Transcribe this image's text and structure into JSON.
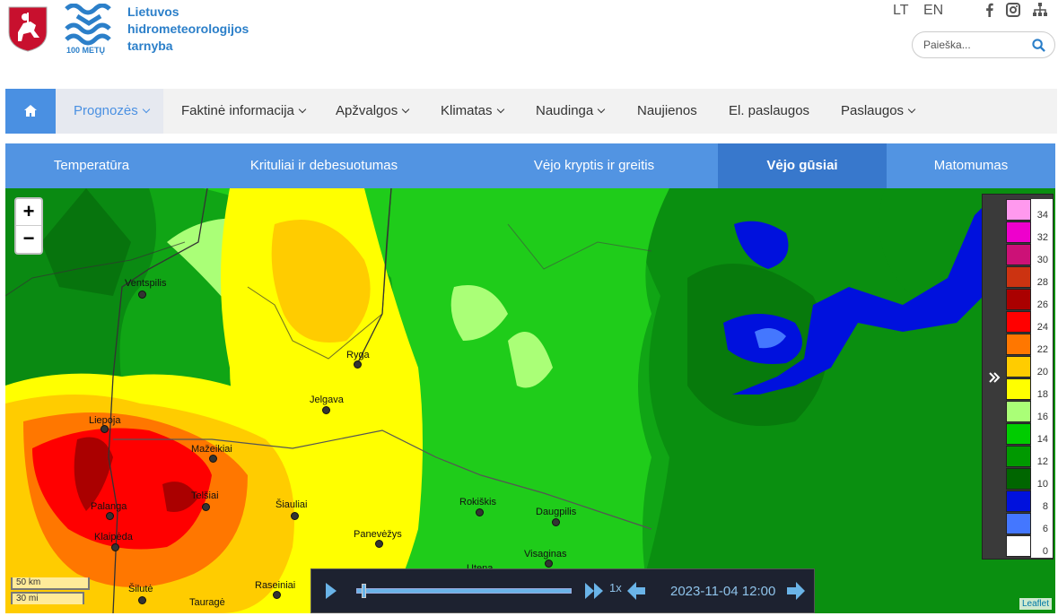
{
  "header": {
    "brand_lines": [
      "Lietuvos",
      "hidrometeorologijos",
      "tarnyba"
    ],
    "logo_caption": "100 METŲ",
    "languages": [
      "LT",
      "EN"
    ],
    "search_placeholder": "Paieška..."
  },
  "nav": {
    "items": [
      {
        "label": "Prognozės",
        "dropdown": true,
        "active": true
      },
      {
        "label": "Faktinė informacija",
        "dropdown": true
      },
      {
        "label": "Apžvalgos",
        "dropdown": true
      },
      {
        "label": "Klimatas",
        "dropdown": true
      },
      {
        "label": "Naudinga",
        "dropdown": true
      },
      {
        "label": "Naujienos",
        "dropdown": false
      },
      {
        "label": "El. paslaugos",
        "dropdown": false
      },
      {
        "label": "Paslaugos",
        "dropdown": true
      }
    ]
  },
  "subtabs": [
    {
      "label": "Temperatūra"
    },
    {
      "label": "Krituliai ir debesuotumas"
    },
    {
      "label": "Vėjo kryptis ir greitis"
    },
    {
      "label": "Vėjo gūsiai",
      "active": true
    },
    {
      "label": "Matomumas"
    }
  ],
  "map": {
    "zoom_in": "+",
    "zoom_out": "−",
    "scale_km": "50 km",
    "scale_mi": "30 mi",
    "attribution": "Leaflet",
    "cities": [
      "Ventspilis",
      "Ryga",
      "Jelgava",
      "Liepoja",
      "Mažeikiai",
      "Telšiai",
      "Šiauliai",
      "Palanga",
      "Klaipėda",
      "Panevėžys",
      "Rokiškis",
      "Daugpilis",
      "Visaginas",
      "Utena",
      "Šilutė",
      "Tauragė",
      "Raseiniai"
    ],
    "legend": [
      {
        "value": "34",
        "color": "#ff99ee"
      },
      {
        "value": "32",
        "color": "#ee00cc"
      },
      {
        "value": "30",
        "color": "#cc1177"
      },
      {
        "value": "28",
        "color": "#cc3311"
      },
      {
        "value": "26",
        "color": "#aa0000"
      },
      {
        "value": "24",
        "color": "#ff0000"
      },
      {
        "value": "22",
        "color": "#ff7700"
      },
      {
        "value": "20",
        "color": "#ffcc00"
      },
      {
        "value": "18",
        "color": "#ffff00"
      },
      {
        "value": "16",
        "color": "#aaff77"
      },
      {
        "value": "14",
        "color": "#00cc00"
      },
      {
        "value": "12",
        "color": "#009900"
      },
      {
        "value": "10",
        "color": "#006600"
      },
      {
        "value": "8",
        "color": "#0011dd"
      },
      {
        "value": "6",
        "color": "#4477ff"
      },
      {
        "value": "0",
        "color": "#ffffff"
      }
    ]
  },
  "player": {
    "speed": "1x",
    "time": "2023-11-04 12:00"
  }
}
